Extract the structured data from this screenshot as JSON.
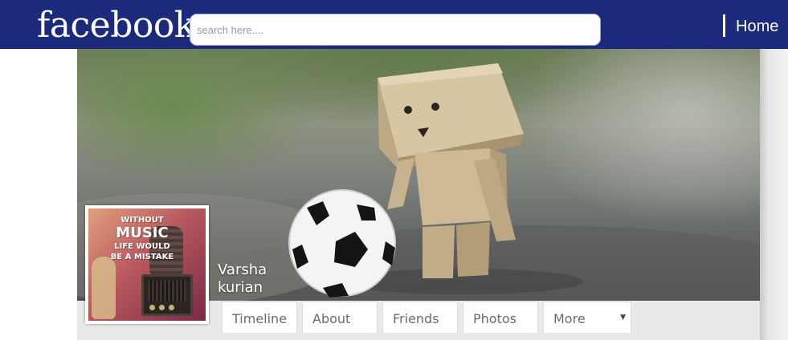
{
  "header": {
    "logo": "facebook",
    "search_placeholder": "search here....",
    "nav_home": "Home"
  },
  "profile": {
    "name_line1": "Varsha",
    "name_line2": "kurian",
    "avatar_text": {
      "line1": "Without",
      "line2": "Music",
      "line3": "Life Would",
      "line4": "Be a Mistake"
    }
  },
  "tabs": [
    {
      "label": "Timeline"
    },
    {
      "label": "About"
    },
    {
      "label": "Friends"
    },
    {
      "label": "Photos"
    },
    {
      "label": "More"
    }
  ],
  "colors": {
    "topbar": "#1c2a7c",
    "tab_text": "#6b6b6b",
    "tabbar_bg": "#e9e9e9"
  }
}
